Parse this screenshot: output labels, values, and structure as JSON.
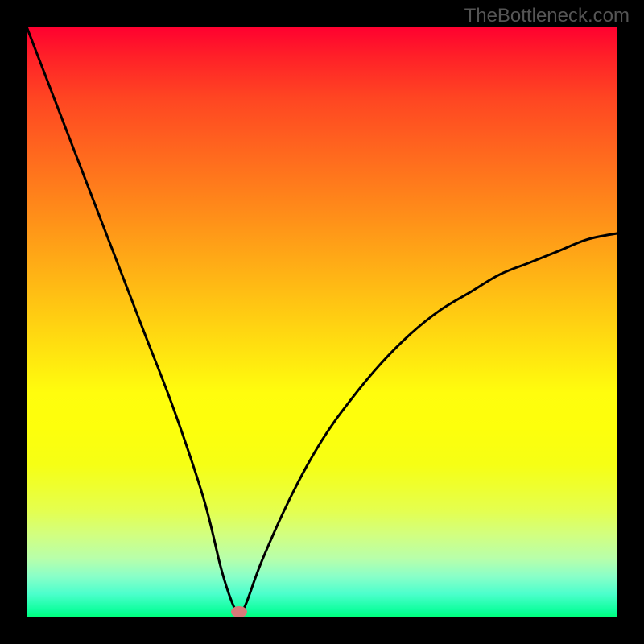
{
  "watermark": "TheBottleneck.com",
  "chart_data": {
    "type": "line",
    "title": "",
    "xlabel": "",
    "ylabel": "",
    "xlim": [
      0,
      100
    ],
    "ylim": [
      0,
      100
    ],
    "background": {
      "type": "vertical-gradient",
      "description": "bottleneck percentage color scale",
      "stops": [
        {
          "pos": 0,
          "color": "#00ff7a",
          "meaning": "optimal"
        },
        {
          "pos": 50,
          "color": "#fffd0d",
          "meaning": "moderate"
        },
        {
          "pos": 100,
          "color": "#ff0030",
          "meaning": "severe bottleneck"
        }
      ]
    },
    "series": [
      {
        "name": "bottleneck-curve",
        "x": [
          0,
          5,
          10,
          15,
          20,
          25,
          30,
          33,
          35,
          36,
          37,
          40,
          45,
          50,
          55,
          60,
          65,
          70,
          75,
          80,
          85,
          90,
          95,
          100
        ],
        "values": [
          100,
          87,
          74,
          61,
          48,
          35,
          20,
          8,
          2,
          1,
          2,
          10,
          21,
          30,
          37,
          43,
          48,
          52,
          55,
          58,
          60,
          62,
          64,
          65
        ]
      }
    ],
    "marker": {
      "x": 36,
      "y": 1,
      "label": "optimal-point"
    },
    "annotations": []
  },
  "colors": {
    "frame": "#000000",
    "curve": "#000000",
    "marker": "#d87a7a",
    "watermark": "#555555"
  }
}
